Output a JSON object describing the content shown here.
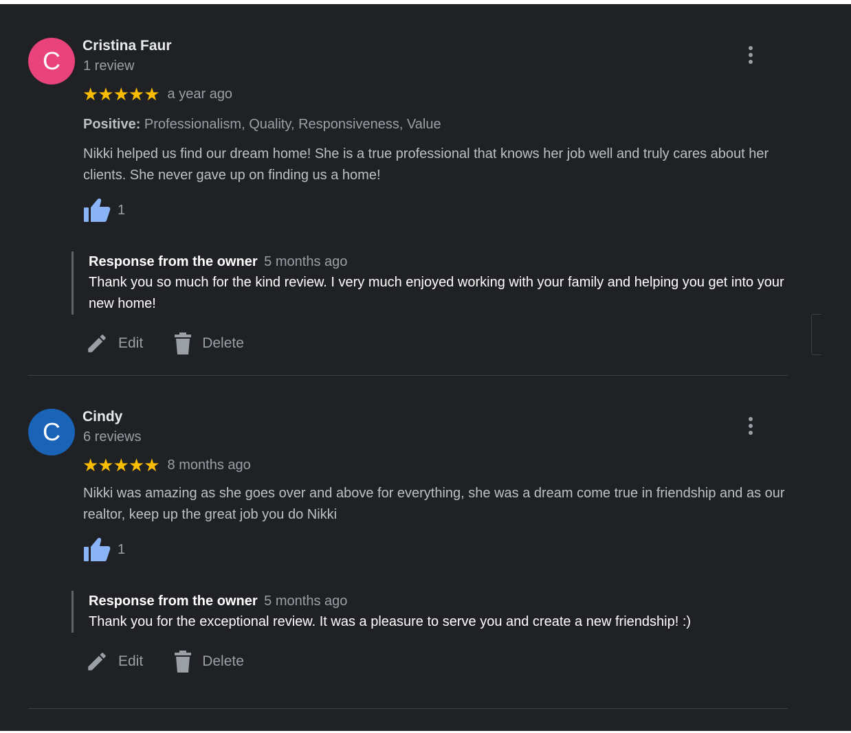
{
  "reviews": [
    {
      "initial": "C",
      "avatar_color": "#e8437b",
      "name": "Cristina Faur",
      "review_count": "1 review",
      "stars": "★★★★★",
      "rating": 5,
      "date": "a year ago",
      "positive_label": "Positive:",
      "positive_values": "Professionalism, Quality, Responsiveness, Value",
      "text": "Nikki helped us find our dream home! She is a true professional that knows her job well and truly cares about her clients. She never gave up on finding us a home!",
      "likes": "1",
      "response": {
        "title": "Response from the owner",
        "date": "5 months ago",
        "text": "Thank you so much for the kind review. I very much enjoyed working with your family and helping you get into your new home!"
      },
      "edit_label": "Edit",
      "delete_label": "Delete"
    },
    {
      "initial": "C",
      "avatar_color": "#1a64b8",
      "name": "Cindy",
      "review_count": "6 reviews",
      "stars": "★★★★★",
      "rating": 5,
      "date": "8 months ago",
      "text": "Nikki was amazing as she goes over and above for everything, she was a dream come true in friendship and as our realtor, keep up the great job you do Nikki",
      "likes": "1",
      "response": {
        "title": "Response from the owner",
        "date": "5 months ago",
        "text": "Thank you for the exceptional review. It was a pleasure to serve you and create a new friendship! :)"
      },
      "edit_label": "Edit",
      "delete_label": "Delete"
    }
  ],
  "colors": {
    "background": "#202124",
    "star": "#fbbc04",
    "thumb": "#8ab4f8"
  },
  "icons": {
    "menu": "more-vert-icon",
    "like": "thumb-up-icon",
    "edit": "pencil-icon",
    "delete": "trash-icon"
  }
}
